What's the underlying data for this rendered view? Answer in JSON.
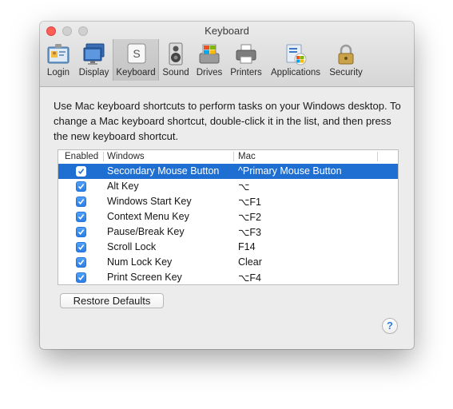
{
  "window": {
    "title": "Keyboard"
  },
  "toolbar": {
    "items": [
      {
        "label": "Login",
        "icon": "login-icon"
      },
      {
        "label": "Display",
        "icon": "display-icon"
      },
      {
        "label": "Keyboard",
        "icon": "keyboard-icon",
        "selected": true
      },
      {
        "label": "Sound",
        "icon": "speaker-icon"
      },
      {
        "label": "Drives",
        "icon": "drive-icon"
      },
      {
        "label": "Printers",
        "icon": "printer-icon"
      },
      {
        "label": "Applications",
        "icon": "applications-icon"
      },
      {
        "label": "Security",
        "icon": "lock-icon"
      }
    ]
  },
  "description": "Use Mac keyboard shortcuts to perform tasks on your Windows desktop. To change a Mac keyboard shortcut, double-click it in the list, and then press the new keyboard shortcut.",
  "table": {
    "columns": {
      "enabled": "Enabled",
      "windows": "Windows",
      "mac": "Mac"
    },
    "rows": [
      {
        "enabled": true,
        "windows": "Secondary Mouse Button",
        "mac": "^Primary Mouse Button",
        "selected": true
      },
      {
        "enabled": true,
        "windows": "Alt Key",
        "mac": "⌥"
      },
      {
        "enabled": true,
        "windows": "Windows Start Key",
        "mac": "⌥F1"
      },
      {
        "enabled": true,
        "windows": "Context Menu Key",
        "mac": "⌥F2"
      },
      {
        "enabled": true,
        "windows": "Pause/Break Key",
        "mac": "⌥F3"
      },
      {
        "enabled": true,
        "windows": "Scroll Lock",
        "mac": "F14"
      },
      {
        "enabled": true,
        "windows": "Num Lock Key",
        "mac": "Clear"
      },
      {
        "enabled": true,
        "windows": "Print Screen Key",
        "mac": "⌥F4"
      }
    ]
  },
  "buttons": {
    "restore": "Restore Defaults",
    "help": "?"
  },
  "colors": {
    "selection": "#1f6fd2",
    "checkbox": "#3a8ef0",
    "close": "#fc5f57"
  }
}
